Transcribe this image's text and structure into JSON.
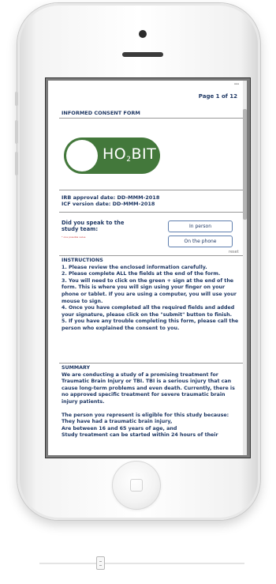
{
  "form": {
    "page_indicator": "Page 1 of 12",
    "title": "INFORMED CONSENT FORM",
    "logo": {
      "text": "HO",
      "sub": "2",
      "text2": "BIT",
      "color": "#43783b"
    },
    "irb_date": "IRB approval date: DD-MMM-2018",
    "icf_date": "ICF version date: DD-MMM-2018",
    "question": "Did you speak to the study team:",
    "required_note": "* one possible value",
    "options": [
      "In person",
      "On the phone"
    ],
    "reset_label": "reset",
    "instructions": {
      "heading": "INSTRUCTIONS",
      "items": [
        "1. Please review the enclosed information carefully.",
        "2. Please complete ALL the fields at the end of the form.",
        "3. You will need to click on the green + sign at the end of the form. This is where you will sign using your finger on your phone or tablet. If you are using a computer, you will use your mouse to sign.",
        "4. Once you have completed all the required fields and added your signature, please click on the \"submit\" button to finish.",
        "5. If you have any trouble completing this form, please call the person who explained the consent to you."
      ]
    },
    "summary": {
      "heading": "SUMMARY",
      "text": "We are conducting a study of a promising treatment for Traumatic Brain Injury or TBI. TBI is a serious injury that can cause long-term problems and even death. Currently, there is no approved specific treatment for severe traumatic brain injury patients.",
      "eligibility_intro": "The person you represent is eligible for this study because:",
      "eligibility_items": [
        "They have had a traumatic brain injury,",
        "Are between 16 and 65 years of age, and",
        "Study treatment can be started within 24 hours of their"
      ]
    }
  }
}
